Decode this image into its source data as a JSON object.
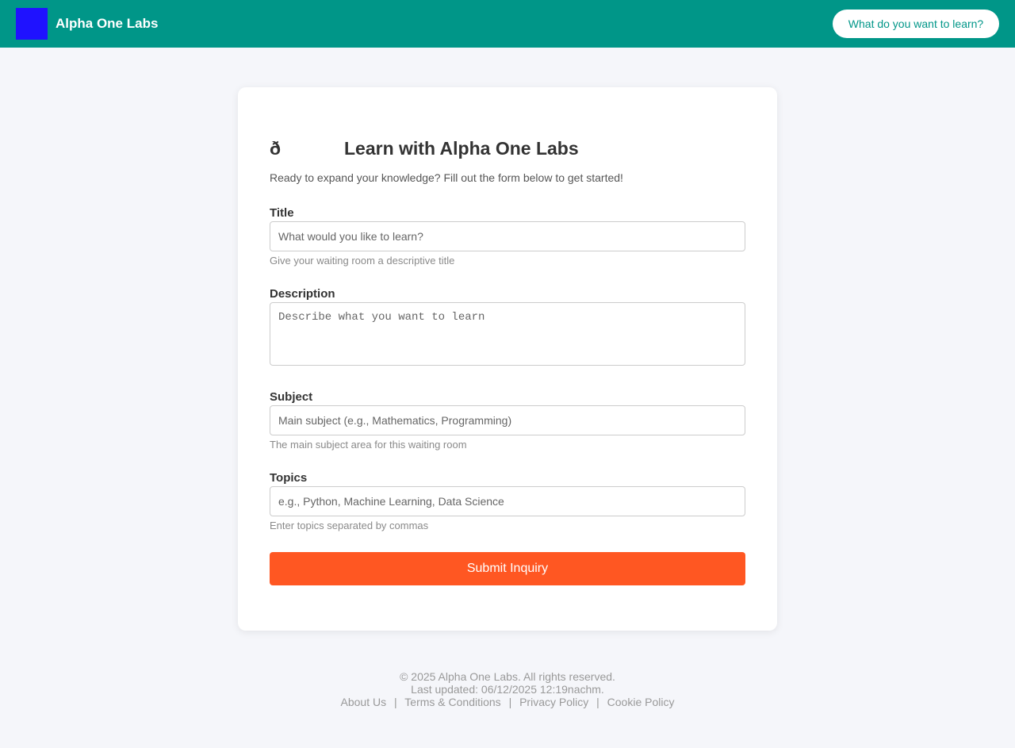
{
  "header": {
    "brand_name": "Alpha One Labs",
    "cta_label": "What do you want to learn?"
  },
  "form": {
    "icon_glyph": "ð",
    "title": "Learn with Alpha One Labs",
    "subtitle": "Ready to expand your knowledge? Fill out the form below to get started!",
    "fields": {
      "title": {
        "label": "Title",
        "placeholder": "What would you like to learn?",
        "value": "",
        "hint": "Give your waiting room a descriptive title"
      },
      "description": {
        "label": "Description",
        "placeholder": "Describe what you want to learn",
        "value": ""
      },
      "subject": {
        "label": "Subject",
        "placeholder": "Main subject (e.g., Mathematics, Programming)",
        "value": "",
        "hint": "The main subject area for this waiting room"
      },
      "topics": {
        "label": "Topics",
        "placeholder": "e.g., Python, Machine Learning, Data Science",
        "value": "",
        "hint": "Enter topics separated by commas"
      }
    },
    "submit_label": "Submit Inquiry"
  },
  "footer": {
    "copyright": "© 2025 Alpha One Labs. All rights reserved.",
    "last_updated": "Last updated: 06/12/2025 12:19nachm.",
    "links": {
      "about": "About Us",
      "terms": "Terms & Conditions",
      "privacy": "Privacy Policy",
      "cookie": "Cookie Policy"
    },
    "separator": "|"
  },
  "colors": {
    "header_bg": "#009688",
    "logo": "#1f12ff",
    "submit_bg": "#ff5722",
    "page_bg": "#f5f6fa"
  }
}
